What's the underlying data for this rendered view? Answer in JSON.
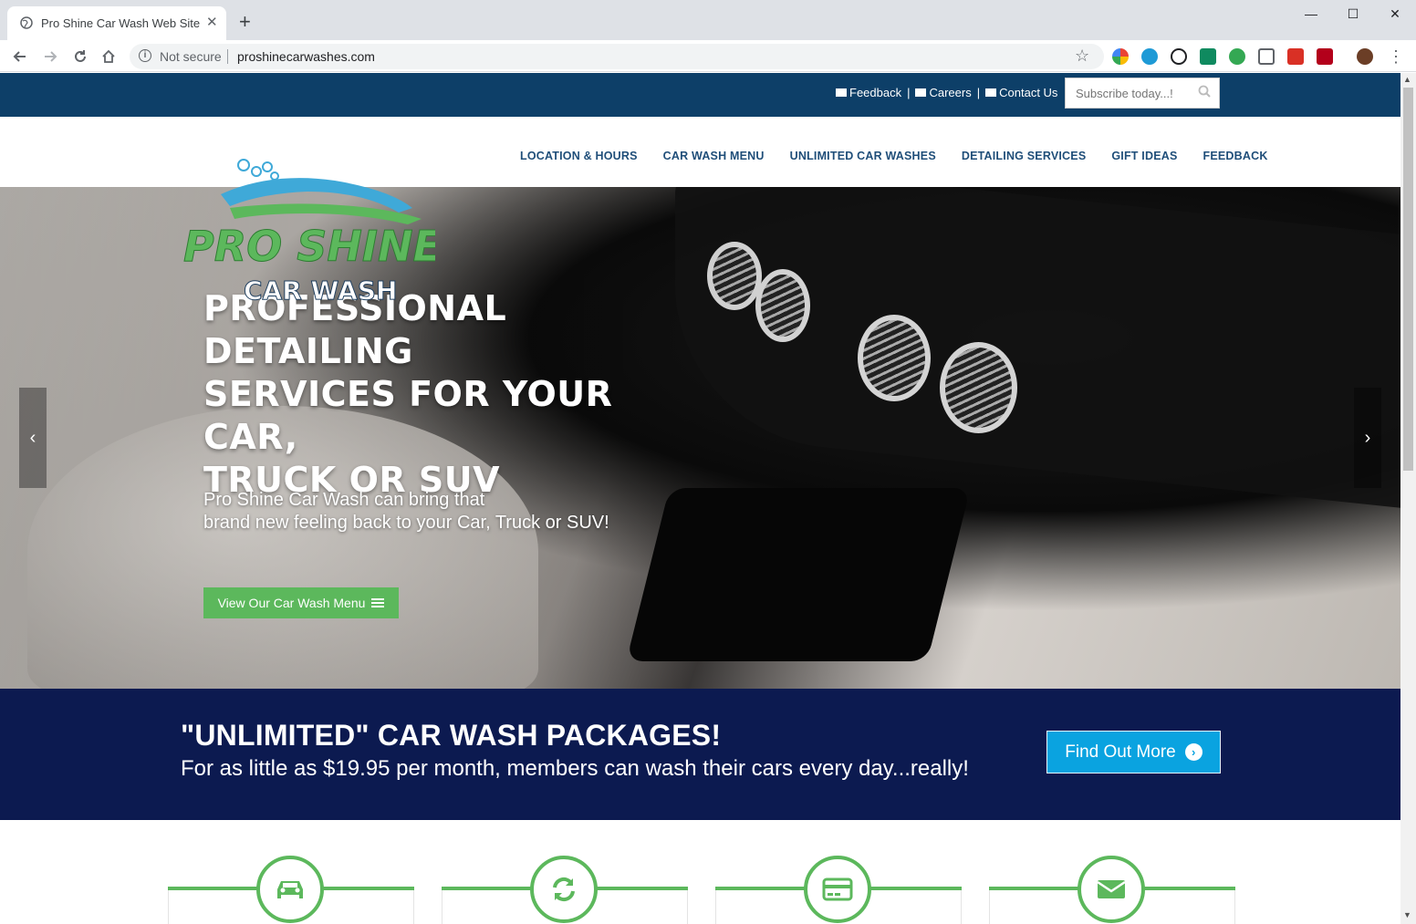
{
  "browser": {
    "tab_title": "Pro Shine Car Wash Web Site",
    "tab_close": "✕",
    "new_tab": "+",
    "minimize": "—",
    "maximize": "☐",
    "close": "✕",
    "not_secure": "Not secure",
    "url": "proshinecarwashes.com",
    "star": "☆",
    "menu_dots": "⋮"
  },
  "topbar": {
    "links": [
      "Feedback",
      "Careers",
      "Contact Us"
    ],
    "separator": "|",
    "subscribe_placeholder": "Subscribe today...!"
  },
  "logo": {
    "line1": "PRO SHINE",
    "line2": "CAR WASH"
  },
  "nav": {
    "items": [
      "LOCATION & HOURS",
      "CAR WASH MENU",
      "UNLIMITED CAR WASHES",
      "DETAILING SERVICES",
      "GIFT IDEAS",
      "FEEDBACK"
    ]
  },
  "hero": {
    "title_lines": [
      "PROFESSIONAL DETAILING",
      "SERVICES FOR YOUR CAR,",
      "TRUCK OR SUV"
    ],
    "sub_lines": [
      "Pro Shine Car Wash can bring that",
      "brand new feeling back to your Car, Truck or SUV!"
    ],
    "button": "View Our Car Wash Menu",
    "prev": "‹",
    "next": "›"
  },
  "promo": {
    "title": "\"UNLIMITED\" CAR WASH PACKAGES!",
    "subtitle": "For as little as $19.95 per month, members can wash their cars every day...really!",
    "button": "Find Out More",
    "button_icon": "›"
  },
  "features": {
    "icons": [
      "car-icon",
      "refresh-icon",
      "credit-card-icon",
      "envelope-icon"
    ]
  },
  "colors": {
    "topbar": "#0d3f68",
    "nav_text": "#1f4e79",
    "green": "#5cb85c",
    "promo_band": "#0c1a50",
    "cta_blue": "#0aa3e0"
  }
}
